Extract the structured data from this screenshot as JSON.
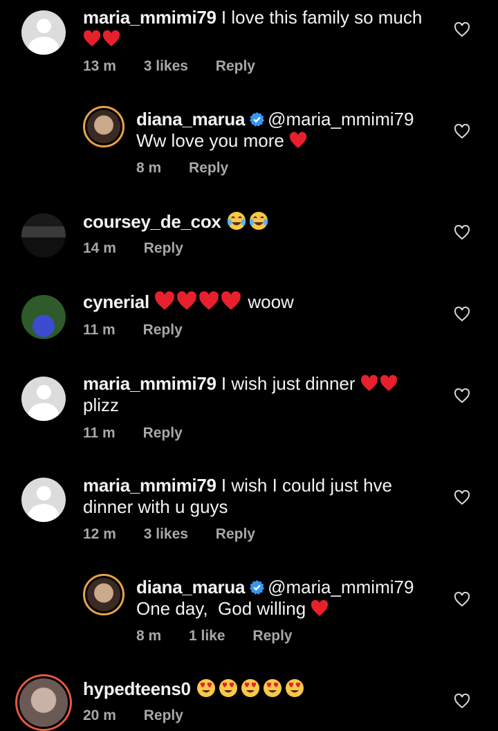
{
  "comments": [
    {
      "username": "maria_mmimi79",
      "text": "I love this family so much",
      "hearts": 2,
      "time": "13 m",
      "likes": "3 likes",
      "reply": "Reply"
    },
    {
      "username": "diana_marua",
      "mention": "@maria_mmimi79",
      "text": "Ww love you more",
      "hearts": 1,
      "time": "8 m",
      "reply": "Reply"
    },
    {
      "username": "coursey_de_cox",
      "emoji": "face-with-tears-of-joy x2",
      "time": "14 m",
      "reply": "Reply"
    },
    {
      "username": "cynerial",
      "hearts": 4,
      "text": "woow",
      "time": "11 m",
      "reply": "Reply"
    },
    {
      "username": "maria_mmimi79",
      "text": "I wish just dinner",
      "text2": "plizz",
      "hearts": 2,
      "time": "11 m",
      "reply": "Reply"
    },
    {
      "username": "maria_mmimi79",
      "text": "I wish I could just hve",
      "text2": "dinner with u guys",
      "time": "12 m",
      "likes": "3 likes",
      "reply": "Reply"
    },
    {
      "username": "diana_marua",
      "mention": "@maria_mmimi79",
      "text": "One day,  God willing",
      "hearts": 1,
      "time": "8 m",
      "likes": "1 like",
      "reply": "Reply"
    },
    {
      "username": "hypedteens0",
      "emoji": "heart-eyes x5",
      "time": "20 m",
      "reply": "Reply"
    }
  ],
  "colors": {
    "background": "#000000",
    "heart": "#e8202e",
    "verified": "#3797f0",
    "meta": "#a8a8a8",
    "story_ring": "#e75a3d"
  }
}
